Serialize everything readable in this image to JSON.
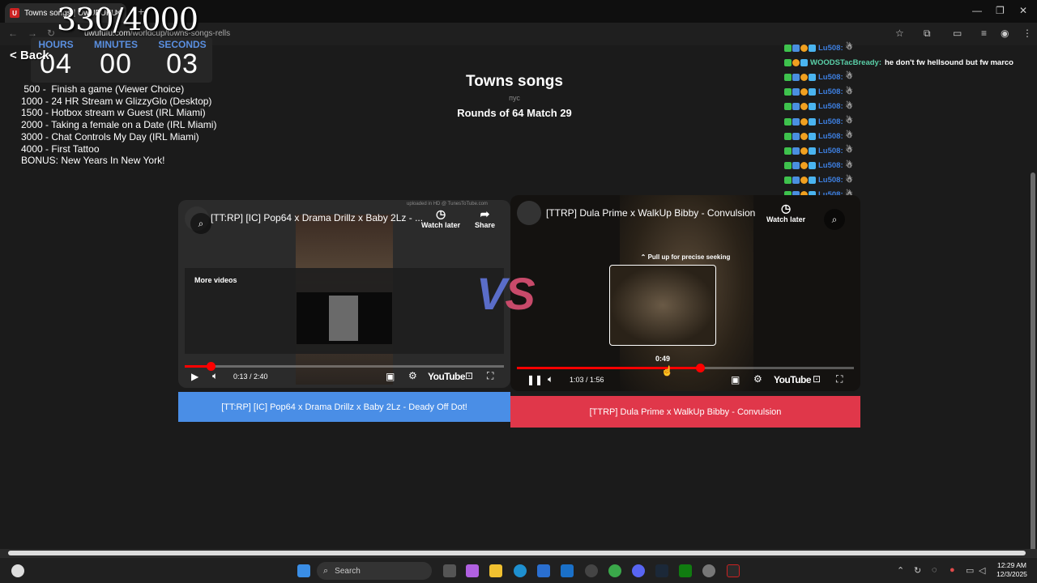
{
  "browser": {
    "tab_title": "Towns songs | UwUFUFU",
    "tab_favicon": "U",
    "url_host": "uwufufu.com",
    "url_path": "/worldcup/towns-songs-rells"
  },
  "overlay": {
    "counter": "330/4000",
    "timer": {
      "hours_label": "HOURS",
      "hours": "04",
      "minutes_label": "MINUTES",
      "minutes": "00",
      "seconds_label": "SECONDS",
      "seconds": "03"
    },
    "goals": [
      " 500 -  Finish a game (Viewer Choice)",
      "1000 - 24 HR Stream w GlizzyGlo (Desktop)",
      "1500 - Hotbox stream w Guest (IRL Miami)",
      "2000 - Taking a female on a Date (IRL Miami)",
      "3000 - Chat Controls My Day (IRL Miami)",
      "4000 - First Tattoo",
      "BONUS: New Years In New York!"
    ]
  },
  "page": {
    "back_label": "Back",
    "title": "Towns songs",
    "subtitle": "пус",
    "round": "Rounds of 64 Match 29",
    "vs_v": "V",
    "vs_s": "S"
  },
  "chat": [
    {
      "name": "Lu508:",
      "message": ""
    },
    {
      "name": "WOODSTacBready:",
      "message": "he don't fw hellsound but fw marco"
    },
    {
      "name": "Lu508:",
      "message": ""
    },
    {
      "name": "Lu508:",
      "message": ""
    },
    {
      "name": "Lu508:",
      "message": ""
    },
    {
      "name": "Lu508:",
      "message": ""
    },
    {
      "name": "Lu508:",
      "message": ""
    },
    {
      "name": "Lu508:",
      "message": ""
    },
    {
      "name": "Lu508:",
      "message": ""
    },
    {
      "name": "Lu508:",
      "message": ""
    },
    {
      "name": "Lu508:",
      "message": ""
    }
  ],
  "left_video": {
    "title": "[TT:RP] [IC] Pop64 x Drama Drillz x Baby 2Lz - ...",
    "watch_later": "Watch later",
    "share": "Share",
    "more_videos": "More videos",
    "time": "0:13 / 2:40",
    "progress": 0.081,
    "uploaded_note": "uploaded in HD @ TunesToTube.com",
    "youtube": "YouTube",
    "vote_label": "[TT:RP] [IC] Pop64 x Drama Drillz x Baby 2Lz - Deady Off Dot!"
  },
  "right_video": {
    "title": "[TTRP] Dula Prime x WalkUp Bibby - Convulsion",
    "watch_later": "Watch later",
    "seek_hint": "Pull up for precise seeking",
    "seek_time": "0:49",
    "time": "1:03 / 1:56",
    "progress": 0.543,
    "youtube": "YouTube",
    "vote_label": "[TTRP] Dula Prime x WalkUp Bibby - Convulsion"
  },
  "taskbar": {
    "search_label": "Search",
    "time": "12:29 AM",
    "date": "12/3/2025"
  },
  "colors": {
    "vote_left": "#4a8ee6",
    "vote_right": "#e0374a",
    "timer_label": "#5a8fe0",
    "progress": "#ff0000"
  }
}
